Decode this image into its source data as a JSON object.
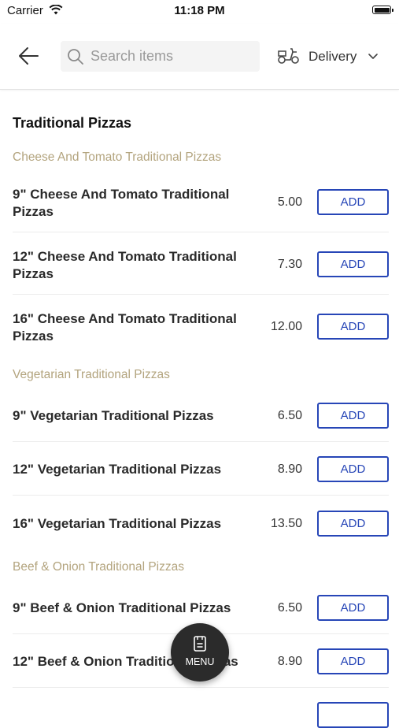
{
  "status_bar": {
    "carrier": "Carrier",
    "time": "11:18 PM"
  },
  "header": {
    "back_icon": "arrow-left-icon",
    "search_placeholder": "Search items",
    "delivery_label": "Delivery",
    "delivery_icon": "scooter-icon"
  },
  "menu": {
    "section_title": "Traditional Pizzas",
    "categories": [
      {
        "name": "Cheese And Tomato Traditional Pizzas",
        "items": [
          {
            "name": "9\" Cheese And Tomato Traditional Pizzas",
            "price": "5.00",
            "action": "ADD"
          },
          {
            "name": "12\" Cheese And Tomato Traditional Pizzas",
            "price": "7.30",
            "action": "ADD"
          },
          {
            "name": "16\" Cheese And Tomato Traditional Pizzas",
            "price": "12.00",
            "action": "ADD"
          }
        ]
      },
      {
        "name": "Vegetarian Traditional Pizzas",
        "items": [
          {
            "name": "9\" Vegetarian Traditional Pizzas",
            "price": "6.50",
            "action": "ADD"
          },
          {
            "name": "12\" Vegetarian Traditional Pizzas",
            "price": "8.90",
            "action": "ADD"
          },
          {
            "name": "16\" Vegetarian Traditional Pizzas",
            "price": "13.50",
            "action": "ADD"
          }
        ]
      },
      {
        "name": "Beef & Onion Traditional Pizzas",
        "items": [
          {
            "name": "9\" Beef & Onion Traditional Pizzas",
            "price": "6.50",
            "action": "ADD"
          },
          {
            "name": "12\" Beef & Onion Traditional Pizzas",
            "price": "8.90",
            "action": "ADD"
          },
          {
            "name": "",
            "price": "",
            "action": ""
          }
        ]
      }
    ]
  },
  "menu_fab": {
    "label": "MENU",
    "icon": "menu-book-icon"
  },
  "colors": {
    "accent": "#2746b7",
    "category_text": "#b3a47e",
    "fab_background": "#2b2b2b"
  }
}
